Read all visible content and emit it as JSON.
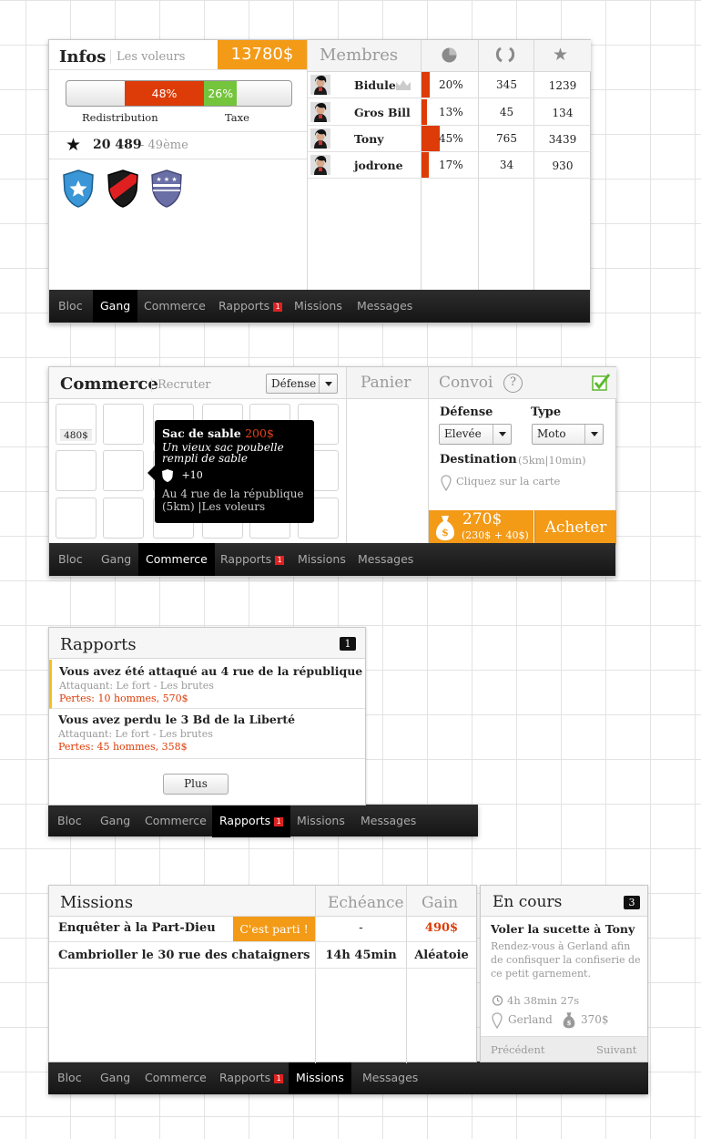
{
  "nav": {
    "bloc": "Bloc",
    "gang": "Gang",
    "commerce": "Commerce",
    "rapports": "Rapports",
    "rapports_badge": "1",
    "missions": "Missions",
    "messages": "Messages"
  },
  "infos": {
    "title": "Infos",
    "subtitle": "Les voleurs",
    "money": "13780$",
    "bar": {
      "redistribution_pct": "48%",
      "taxe_pct": "26%",
      "redistribution_value": 48,
      "taxe_value": 26,
      "redistribution_label": "Redistribution",
      "taxe_label": "Taxe"
    },
    "score": "20 489",
    "rank": "- 49ème",
    "members_title": "Membres",
    "members": [
      {
        "name": "Bidule",
        "pct": "20%",
        "pct_value": 20,
        "c2": "345",
        "c3": "1239",
        "crown": true
      },
      {
        "name": "Gros Bill",
        "pct": "13%",
        "pct_value": 13,
        "c2": "45",
        "c3": "134",
        "crown": false
      },
      {
        "name": "Tony",
        "pct": "45%",
        "pct_value": 45,
        "c2": "765",
        "c3": "3439",
        "crown": false
      },
      {
        "name": "jodrone",
        "pct": "17%",
        "pct_value": 17,
        "c2": "34",
        "c3": "930",
        "crown": false
      }
    ]
  },
  "commerce": {
    "title": "Commerce",
    "recruit": "Recruter",
    "filter": "Défense",
    "cell_price": "480$",
    "panier": "Panier",
    "convoi": "Convoi",
    "help": "?",
    "tooltip": {
      "name": "Sac de sable",
      "price": "200$",
      "desc": "Un vieux sac poubelle rempli de sable",
      "bonus": "+10",
      "address": "Au 4 rue de la république",
      "distance": "(5km)",
      "gang": "|Les voleurs"
    },
    "defense_label": "Défense",
    "defense_value": "Elevée",
    "type_label": "Type",
    "type_value": "Moto",
    "destination_label": "Destination",
    "destination_info": "(5km|10min)",
    "map_hint": "Cliquez sur la carte",
    "total": "270$",
    "total_detail": "(230$ + 40$)",
    "buy": "Acheter"
  },
  "rapports": {
    "title": "Rapports",
    "count": "1",
    "more": "Plus",
    "items": [
      {
        "title": "Vous avez été attaqué au 4 rue de la république",
        "attacker": "Attaquant: Le fort - Les brutes",
        "losses": "Pertes: 10 hommes, 570$"
      },
      {
        "title": "Vous avez perdu le 3 Bd de la Liberté",
        "attacker": "Attaquant: Le fort - Les brutes",
        "losses": "Pertes: 45 hommes, 358$"
      }
    ]
  },
  "missions": {
    "title": "Missions",
    "col_deadline": "Echéance",
    "col_gain": "Gain",
    "rows": [
      {
        "name": "Enquêter à la Part-Dieu",
        "tag": "C'est parti !",
        "deadline": "-",
        "gain": "490$"
      },
      {
        "name": "Cambrioller le 30 rue des chataigners",
        "tag": "",
        "deadline": "14h 45min",
        "gain": "Aléatoie"
      }
    ]
  },
  "encours": {
    "title": "En cours",
    "count": "3",
    "mission": "Voler la sucette à Tony",
    "desc": "Rendez-vous à Gerland afin de confisquer la confiserie de ce petit garnement.",
    "time": "4h 38min 27s",
    "place": "Gerland",
    "reward": "370$",
    "prev": "Précédent",
    "next": "Suivant"
  },
  "colors": {
    "accent": "#f39a17",
    "red": "#dd3b07",
    "green": "#74c43c",
    "check": "#5cb82e",
    "shield_blue": "#3a96d6",
    "shield_purple": "#6a6fa6"
  }
}
